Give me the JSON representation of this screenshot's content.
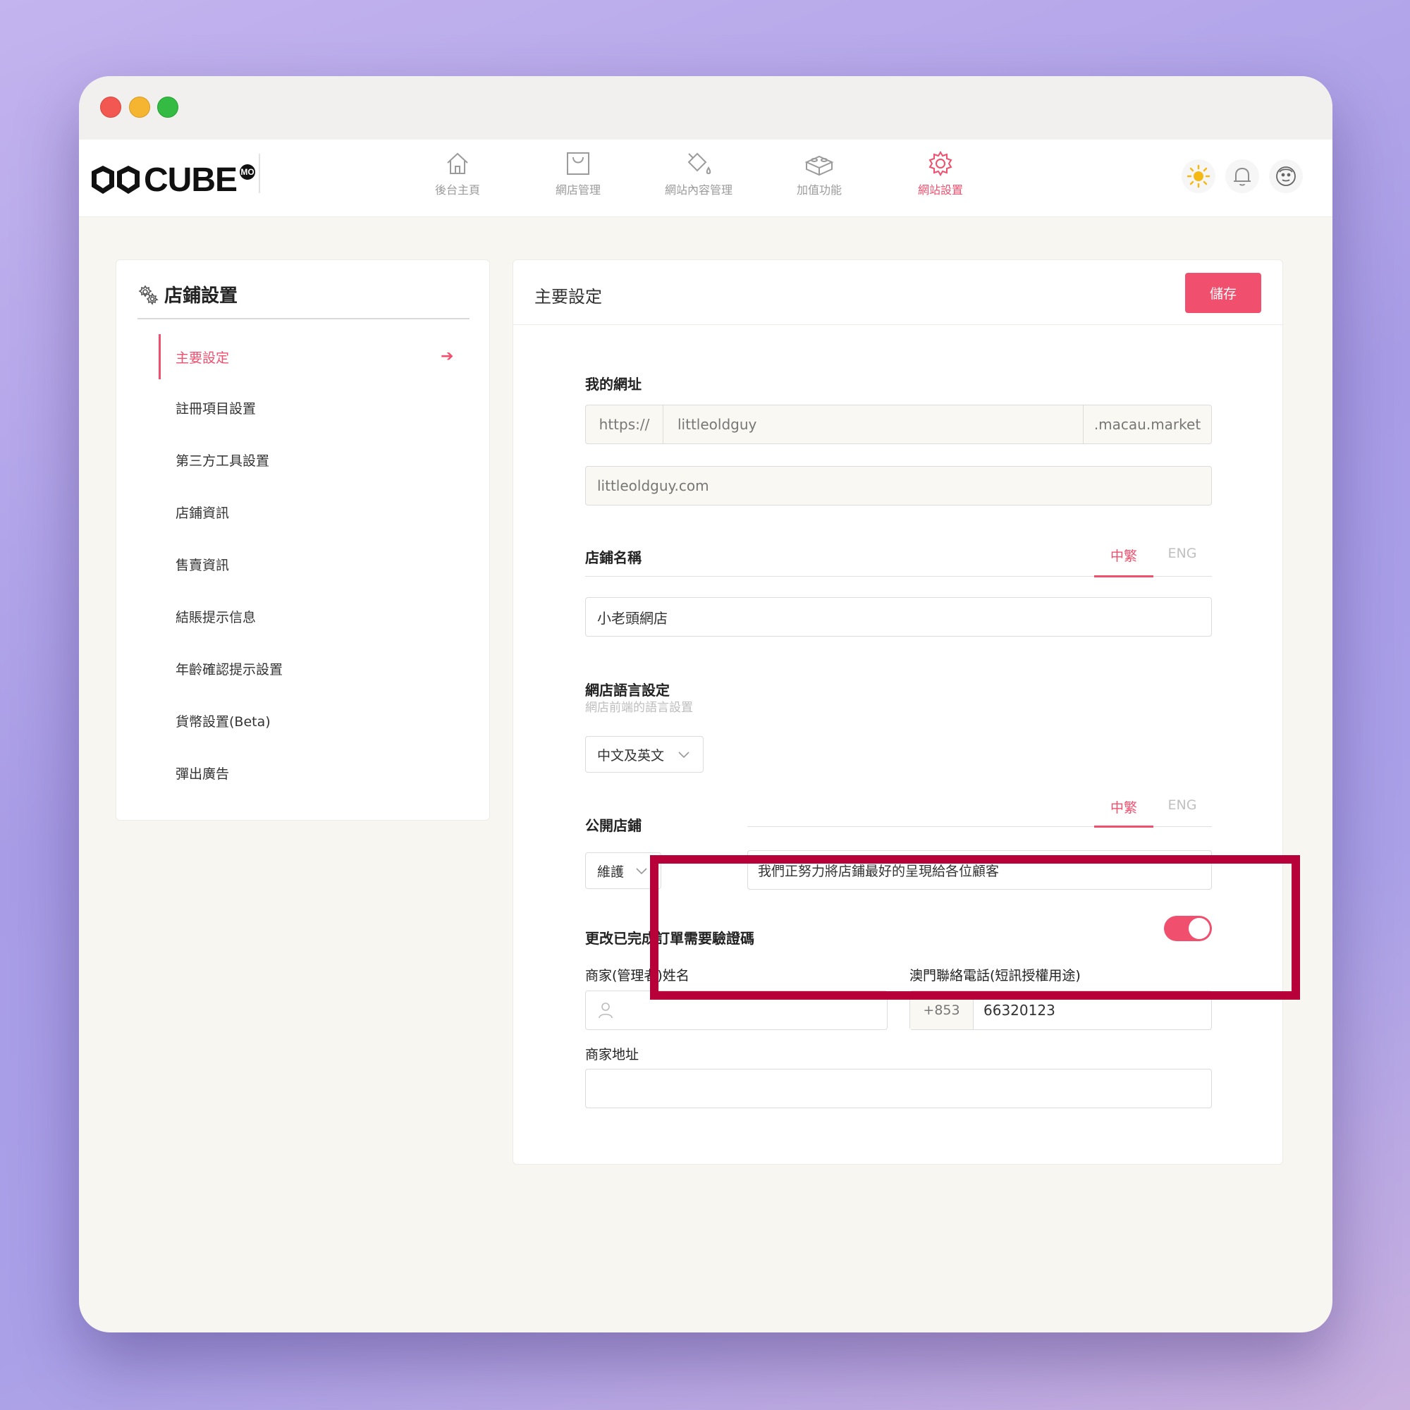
{
  "app": {
    "logo_text": "CUBE",
    "logo_badge": "MO"
  },
  "nav": [
    {
      "label": "後台主頁",
      "icon": "home-icon"
    },
    {
      "label": "網店管理",
      "icon": "shopping-bag-icon"
    },
    {
      "label": "網站內容管理",
      "icon": "paint-bucket-icon"
    },
    {
      "label": "加值功能",
      "icon": "lego-brick-icon"
    },
    {
      "label": "網站設置",
      "icon": "gear-icon"
    }
  ],
  "header_icons": [
    "sun-icon",
    "bell-icon",
    "avatar-icon"
  ],
  "sidebar": {
    "title": "店鋪設置",
    "items": [
      {
        "label": "主要設定"
      },
      {
        "label": "註冊項目設置"
      },
      {
        "label": "第三方工具設置"
      },
      {
        "label": "店鋪資訊"
      },
      {
        "label": "售賣資訊"
      },
      {
        "label": "結賬提示信息"
      },
      {
        "label": "年齡確認提示設置"
      },
      {
        "label": "貨幣設置(Beta)"
      },
      {
        "label": "彈出廣告"
      }
    ]
  },
  "main": {
    "title": "主要設定",
    "save_label": "儲存",
    "url": {
      "label": "我的網址",
      "prefix": "https://",
      "subdomain": "littleoldguy",
      "suffix": ".macau.market",
      "custom_domain": "littleoldguy.com"
    },
    "shop_name": {
      "label": "店鋪名稱",
      "tab_zh": "中繁",
      "tab_en": "ENG",
      "value": "小老頭網店"
    },
    "language": {
      "label": "網店語言設定",
      "sublabel": "網店前端的語言設置",
      "selected": "中文及英文"
    },
    "public_shop": {
      "label": "公開店鋪",
      "tab_zh": "中繁",
      "tab_en": "ENG",
      "status": "維護",
      "message": "我們正努力將店鋪最好的呈現給各位顧客"
    },
    "verify_code": {
      "label": "更改已完成訂單需要驗證碼",
      "enabled": true
    },
    "merchant_name": {
      "label": "商家(管理者)姓名",
      "value": ""
    },
    "phone": {
      "label": "澳門聯絡電話(短訊授權用途)",
      "country_code": "+853",
      "number": "66320123"
    },
    "address": {
      "label": "商家地址",
      "value": ""
    }
  },
  "colors": {
    "accent": "#f0506e",
    "highlight": "#b7003a"
  }
}
